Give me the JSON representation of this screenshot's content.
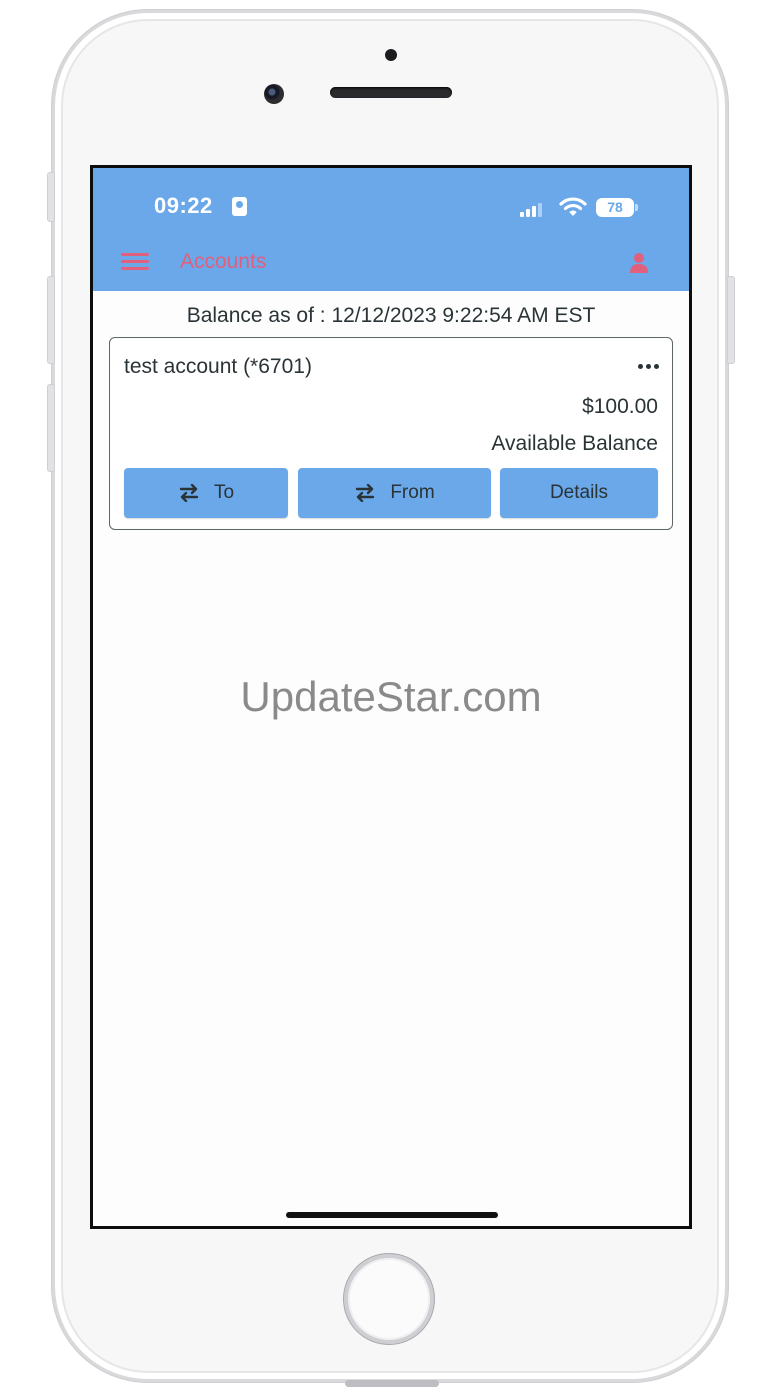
{
  "status_bar": {
    "time": "09:22",
    "battery": "78",
    "icons": [
      "id-card-icon",
      "cellular-signal-icon",
      "wifi-icon",
      "battery-icon"
    ]
  },
  "app_bar": {
    "title": "Accounts",
    "menu_icon": "hamburger-menu-icon",
    "profile_icon": "user-icon",
    "background_color": "#6aa8ea",
    "accent_color": "#e0607e"
  },
  "balance_as_of": "Balance as of : 12/12/2023 9:22:54 AM EST",
  "account": {
    "name": "test account (*6701)",
    "amount": "$100.00",
    "amount_label": "Available Balance",
    "more_icon": "more-horizontal-icon",
    "buttons": {
      "to": "To",
      "from": "From",
      "details": "Details"
    }
  },
  "watermark": "UpdateStar.com"
}
